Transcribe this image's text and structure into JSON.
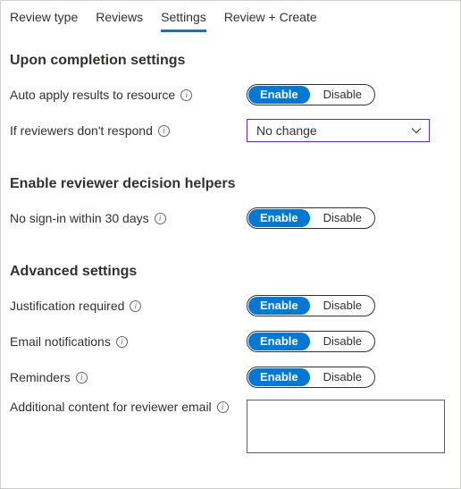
{
  "tabs": {
    "review_type": "Review type",
    "reviews": "Reviews",
    "settings": "Settings",
    "review_create": "Review + Create"
  },
  "toggle": {
    "enable": "Enable",
    "disable": "Disable"
  },
  "sections": {
    "completion": {
      "title": "Upon completion settings",
      "auto_apply": "Auto apply results to resource",
      "if_no_respond": "If reviewers don't respond",
      "dropdown_value": "No change"
    },
    "helpers": {
      "title": "Enable reviewer decision helpers",
      "no_signin": "No sign-in within 30 days"
    },
    "advanced": {
      "title": "Advanced settings",
      "justification": "Justification required",
      "email_notifications": "Email notifications",
      "reminders": "Reminders",
      "additional_content": "Additional content for reviewer email"
    }
  }
}
